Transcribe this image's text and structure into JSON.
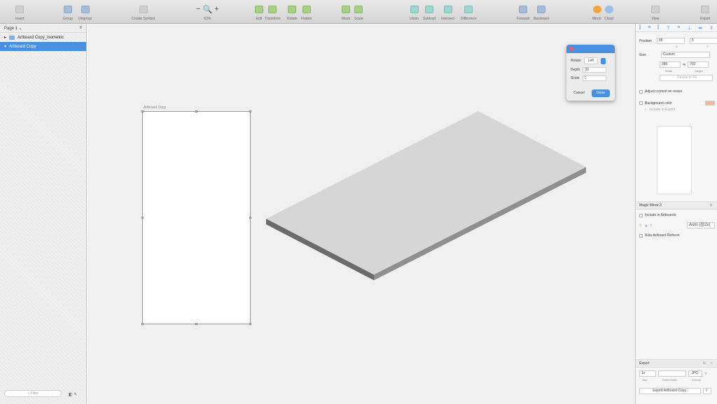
{
  "toolbar": {
    "insert": "Insert",
    "group": "Group",
    "ungroup": "Ungroup",
    "create_symbol": "Create Symbol",
    "zoom_minus": "−",
    "zoom_icon": "🔍",
    "zoom_plus": "+",
    "zoom": "63%",
    "edit": "Edit",
    "transform": "Transform",
    "rotate": "Rotate",
    "flatten": "Flatten",
    "mask": "Mask",
    "scale": "Scale",
    "union": "Union",
    "subtract": "Subtract",
    "intersect": "Intersect",
    "difference": "Difference",
    "forward": "Forward",
    "backward": "Backward",
    "mirror": "Mirror",
    "cloud": "Cloud",
    "view": "View",
    "export": "Export"
  },
  "layers": {
    "page": "Page 1 ⌄",
    "items": [
      "Artboard Copy_Isometric",
      "Artboard Copy"
    ],
    "filter_placeholder": "Filter"
  },
  "canvas": {
    "artboard_label": "Artboard Copy"
  },
  "dialog": {
    "rotate_label": "Rotate",
    "rotate_value": "Left",
    "depth_label": "Depth",
    "depth_value": "20",
    "scale_label": "Scale",
    "scale_value": "1",
    "cancel": "Cancel",
    "done": "Done"
  },
  "inspector": {
    "position_label": "Position",
    "x_value": "98",
    "y_value": "0",
    "x_label": "X",
    "y_label": "Y",
    "size_label": "Size",
    "size_preset": "Custom",
    "width_value": "386",
    "height_value": "702",
    "width_label": "Width",
    "height_label": "Height",
    "resize_button": "Resize to Fit",
    "adjust_content": "Adjust content on resize",
    "background_color": "Background color",
    "include_export": "Include in Export",
    "magic_mirror": "Magic Mirror 3",
    "include_artboards": "Include in Artboards",
    "quality": "Auto (@2x)",
    "auto_refresh": "Auto Artboard Refresh",
    "export_header": "Export",
    "export_size": "1x",
    "export_format": ".JPG",
    "size_col": "Size",
    "prefix_col": "Prefix/Suffix",
    "format_col": "Format",
    "export_button": "Export Artboard Copy..."
  },
  "colors": {
    "accent": "#4a90e2",
    "swatch": "#f2b8aa"
  }
}
